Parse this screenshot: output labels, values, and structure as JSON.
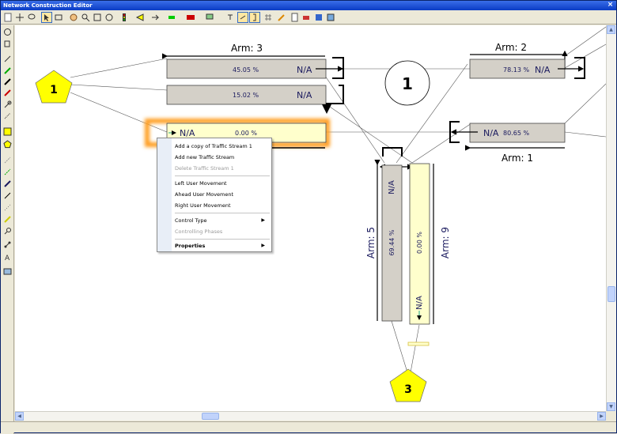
{
  "window": {
    "title": "Network Construction Editor",
    "close_glyph": "×"
  },
  "diagram": {
    "arms": [
      {
        "label": "Arm: 3"
      },
      {
        "label": "Arm: 2"
      },
      {
        "label": "Arm: 1"
      },
      {
        "label": "Arm: 5"
      },
      {
        "label": "Arm: 9"
      }
    ],
    "streams": [
      {
        "pct": "45.05 %",
        "value": "N/A"
      },
      {
        "pct": "15.02 %",
        "value": "N/A"
      },
      {
        "pct": "0.00 %",
        "value": "N/A"
      },
      {
        "pct": "78.13 %",
        "value": "N/A"
      },
      {
        "pct": "80.65 %",
        "value": "N/A"
      },
      {
        "pct": "69.44 %",
        "value": "N/A"
      },
      {
        "pct": "0.00 %",
        "value": "N/A"
      }
    ],
    "nodes": [
      {
        "label": "1"
      },
      {
        "label": "1"
      },
      {
        "label": "3"
      }
    ]
  },
  "context_menu": {
    "items": [
      {
        "label": "Add a copy of Traffic Stream 1",
        "enabled": true
      },
      {
        "label": "Add new Traffic Stream",
        "enabled": true
      },
      {
        "label": "Delete Traffic Stream 1",
        "enabled": false
      },
      {
        "label": "Left User Movement",
        "enabled": true
      },
      {
        "label": "Ahead User Movement",
        "enabled": true
      },
      {
        "label": "Right User Movement",
        "enabled": true
      },
      {
        "label": "Control Type",
        "enabled": true,
        "submenu": "▶"
      },
      {
        "label": "Controlling Phases",
        "enabled": false
      },
      {
        "label": "Properties",
        "enabled": true,
        "submenu": "▶"
      }
    ]
  },
  "colors": {
    "stream_fill": "#d4d0c8",
    "selected_fill": "#ffffcc",
    "node_yellow": "#ffff00",
    "highlight": "#ff9b1e",
    "text_navy": "#1a1a5e"
  }
}
